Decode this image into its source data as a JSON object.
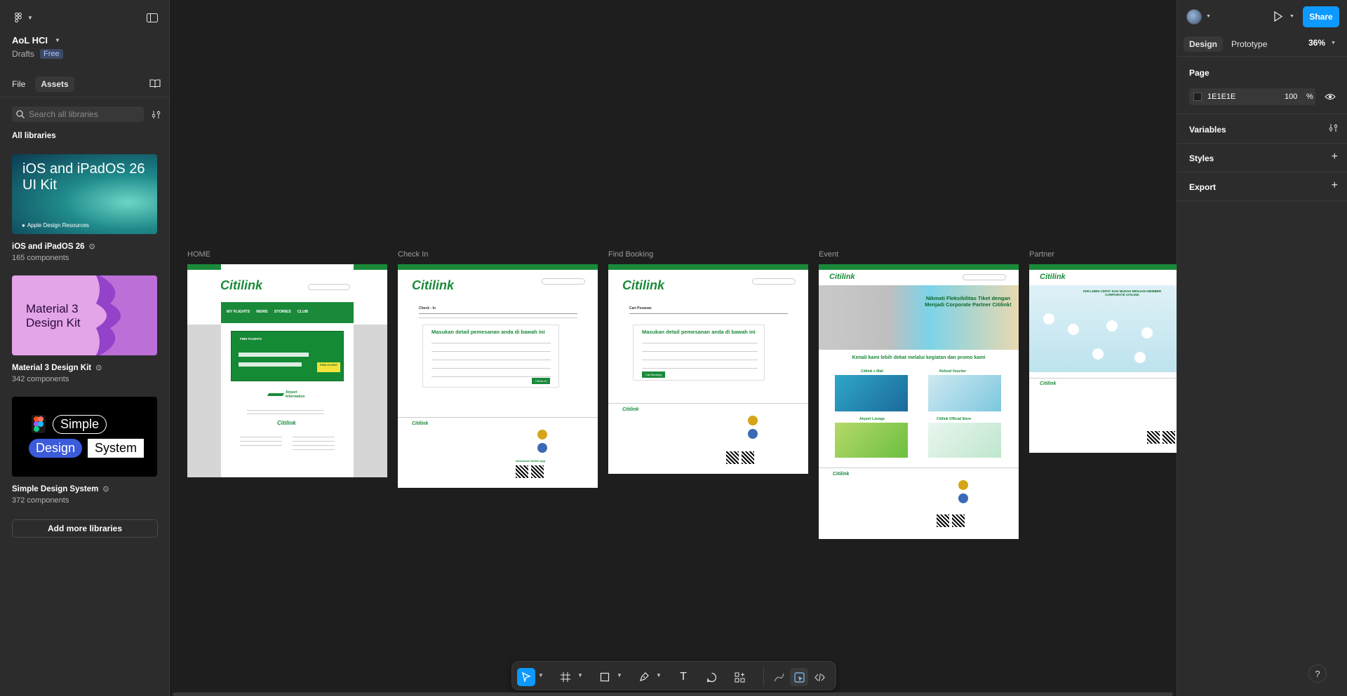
{
  "file": {
    "name": "AoL HCI",
    "location": "Drafts",
    "plan": "Free"
  },
  "left_panel": {
    "tabs": [
      {
        "label": "File"
      },
      {
        "label": "Assets"
      }
    ],
    "search_placeholder": "Search all libraries",
    "section_title": "All libraries",
    "libraries": [
      {
        "name": "iOS and iPadOS 26",
        "components": "165 components",
        "thumb_title": "iOS and iPadOS 26 UI Kit",
        "thumb_footer": "Apple Design Resources"
      },
      {
        "name": "Material 3 Design Kit",
        "components": "342 components",
        "thumb_title": "Material 3 Design Kit"
      },
      {
        "name": "Simple Design System",
        "components": "372 components",
        "thumb_words": [
          "Simple",
          "Design",
          "System"
        ]
      }
    ],
    "add_button": "Add more libraries"
  },
  "right_panel": {
    "share_label": "Share",
    "tabs": [
      {
        "label": "Design"
      },
      {
        "label": "Prototype"
      }
    ],
    "zoom": "36%",
    "page_section": "Page",
    "page_color": "1E1E1E",
    "page_opacity": "100",
    "percent": "%",
    "sections": [
      {
        "label": "Variables"
      },
      {
        "label": "Styles"
      },
      {
        "label": "Export"
      }
    ]
  },
  "canvas": {
    "frames": [
      {
        "label": "HOME"
      },
      {
        "label": "Check In"
      },
      {
        "label": "Find Booking"
      },
      {
        "label": "Event"
      },
      {
        "label": "Partner"
      }
    ],
    "content": {
      "brand": "Citilink",
      "search": "Search",
      "home_nav": [
        "MY FLIGHTS",
        "NEWS",
        "STORIES",
        "CLUB"
      ],
      "home_button": "FIND FLIGHT",
      "home_find_flights": "FIND FLIGHTS",
      "airport_info": "Airport Information",
      "checkin_heading": "Check - In",
      "booking_heading": "Cari Pesanan",
      "form_title": "Masukan detail pemesanan anda di bawah ini",
      "checkin_button": "Check-In",
      "booking_button": "Cari Booking",
      "event_headline": "Nikmati Fleksibilitas Tiket dengan Menjadi Corporate Partner Citilink!",
      "event_subtitle": "Kenali kami lebih dekat melalui kegiatan dan promo kami",
      "event_card_labels": [
        "Citilink x Mall",
        "Refund Voucher",
        "Airport Lounge",
        "Citilink Official Store"
      ],
      "partner_headline": "KINI LEBIH CEPAT DAN MUDAH MENJADI MEMBER CORPORATE CITILINK",
      "download_app": "Download Citilink App"
    }
  },
  "toolbar": {
    "tools": [
      "move-tool",
      "frame-tool",
      "shape-tool",
      "pen-tool",
      "text-tool",
      "comment-tool",
      "actions-tool",
      "draw-mode",
      "design-mode",
      "dev-mode"
    ]
  },
  "help_label": "?"
}
